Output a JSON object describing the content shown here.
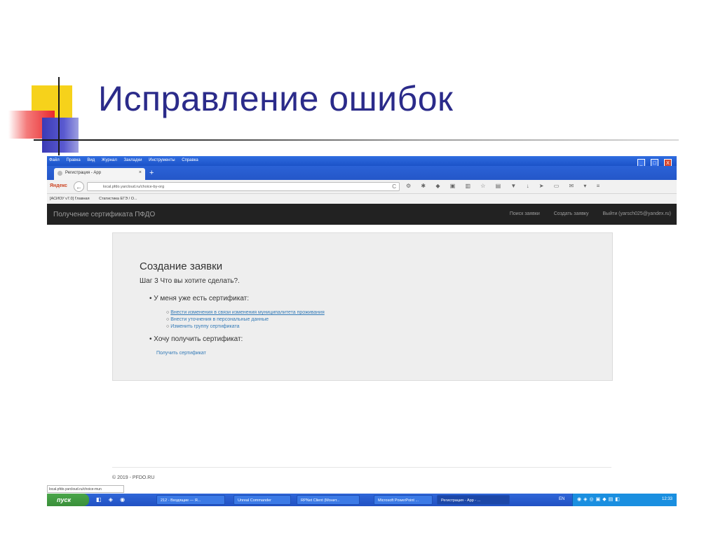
{
  "slide": {
    "title": "Исправление ошибок"
  },
  "browser": {
    "menu": [
      "Файл",
      "Правка",
      "Вид",
      "Журнал",
      "Закладки",
      "Инструменты",
      "Справка"
    ],
    "window_buttons": {
      "minimize": "_",
      "maximize": "□",
      "close": "X"
    },
    "tab": {
      "label": "Регистрация - App",
      "close": "×"
    },
    "new_tab": "+",
    "search_brand": "Яндекс",
    "back": "←",
    "url": "local.pfdo.yarcloud.ru/choice-by-org",
    "reload": "C",
    "toolbar_icons": "⚙ ✱ ◆ ▣ ▥ ☆ ▤ ▼ ↓ ➤ ▭ ✉ ▾ ≡",
    "bookmarks": [
      "[АСИОУ v7.0] Главная",
      "Статистика ЕГЭ / О..."
    ]
  },
  "app": {
    "brand": "Получение сертификата ПФДО",
    "nav": [
      "Поиск заявки",
      "Создать заявку",
      "Выйти (yarsch025@yandex.ru)"
    ],
    "card": {
      "title": "Создание заявки",
      "step": "Шаг 3 Что вы хотите сделать?.",
      "option1": "У меня уже есть сертификат:",
      "sub_options": [
        "Внести изменения в связи изменения муниципалитета проживания",
        "Внести уточнения в персональные данные",
        "Изменить группу сертификата"
      ],
      "option2": "Хочу получить сертификат:",
      "get_cert": "Получить сертификат",
      "bullet": "•",
      "sub_bullet": "○"
    },
    "footer": "© 2019 - PFDO.RU",
    "status_url": "local.pfdo.yarcloud.ru/choice-mun"
  },
  "taskbar": {
    "start": "пуск",
    "quick_launch": "◧ ◈ ◉",
    "tasks": [
      "212 - Входящие — Я...",
      "Unreal Commander",
      "RPNet Client (Монит...",
      "Microsoft PowerPoint ...",
      "Регистрация - App - ..."
    ],
    "lang": "EN",
    "tray_icons": "◉◈◎▣◆▤◧",
    "clock": "12:33"
  }
}
